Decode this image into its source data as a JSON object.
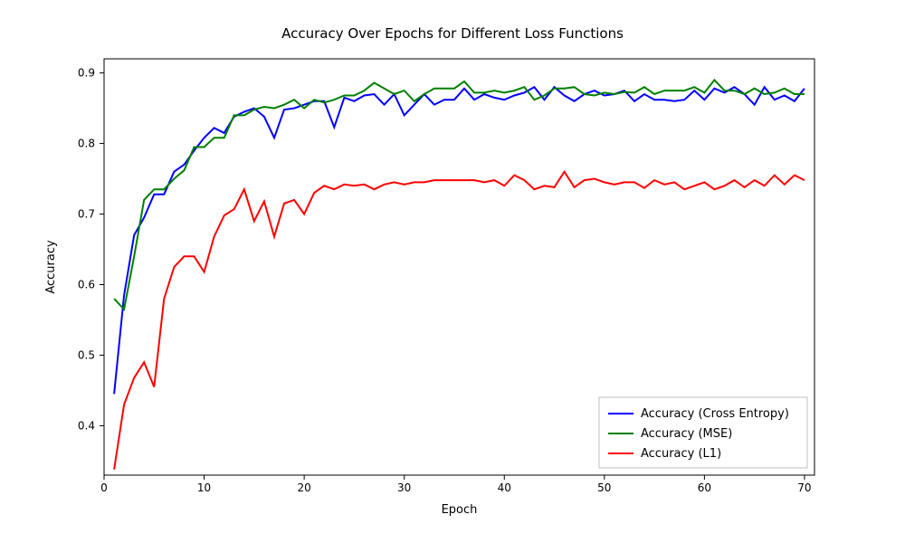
{
  "chart_data": {
    "type": "line",
    "title": "Accuracy Over Epochs for Different Loss Functions",
    "xlabel": "Epoch",
    "ylabel": "Accuracy",
    "xlim": [
      0,
      71
    ],
    "ylim": [
      0.33,
      0.92
    ],
    "xticks": [
      0,
      10,
      20,
      30,
      40,
      50,
      60,
      70
    ],
    "yticks": [
      0.4,
      0.5,
      0.6,
      0.7,
      0.8,
      0.9
    ],
    "x": [
      1,
      2,
      3,
      4,
      5,
      6,
      7,
      8,
      9,
      10,
      11,
      12,
      13,
      14,
      15,
      16,
      17,
      18,
      19,
      20,
      21,
      22,
      23,
      24,
      25,
      26,
      27,
      28,
      29,
      30,
      31,
      32,
      33,
      34,
      35,
      36,
      37,
      38,
      39,
      40,
      41,
      42,
      43,
      44,
      45,
      46,
      47,
      48,
      49,
      50,
      51,
      52,
      53,
      54,
      55,
      56,
      57,
      58,
      59,
      60,
      61,
      62,
      63,
      64,
      65,
      66,
      67,
      68,
      69,
      70
    ],
    "series": [
      {
        "name": "Accuracy (Cross Entropy)",
        "color": "#0000ff",
        "values": [
          0.445,
          0.585,
          0.67,
          0.695,
          0.728,
          0.728,
          0.76,
          0.77,
          0.79,
          0.808,
          0.822,
          0.815,
          0.838,
          0.845,
          0.85,
          0.838,
          0.808,
          0.848,
          0.85,
          0.855,
          0.86,
          0.86,
          0.823,
          0.865,
          0.86,
          0.868,
          0.87,
          0.855,
          0.87,
          0.84,
          0.855,
          0.87,
          0.855,
          0.862,
          0.862,
          0.878,
          0.862,
          0.87,
          0.865,
          0.862,
          0.868,
          0.872,
          0.88,
          0.862,
          0.88,
          0.868,
          0.86,
          0.87,
          0.875,
          0.868,
          0.87,
          0.875,
          0.86,
          0.87,
          0.862,
          0.862,
          0.86,
          0.862,
          0.875,
          0.862,
          0.878,
          0.872,
          0.88,
          0.87,
          0.855,
          0.88,
          0.862,
          0.868,
          0.86,
          0.878
        ]
      },
      {
        "name": "Accuracy (MSE)",
        "color": "#008000",
        "values": [
          0.58,
          0.565,
          0.64,
          0.72,
          0.735,
          0.735,
          0.75,
          0.762,
          0.795,
          0.795,
          0.808,
          0.808,
          0.84,
          0.84,
          0.848,
          0.852,
          0.85,
          0.855,
          0.862,
          0.85,
          0.862,
          0.858,
          0.862,
          0.868,
          0.868,
          0.875,
          0.886,
          0.878,
          0.87,
          0.875,
          0.86,
          0.87,
          0.878,
          0.878,
          0.878,
          0.888,
          0.872,
          0.872,
          0.875,
          0.872,
          0.875,
          0.88,
          0.862,
          0.868,
          0.878,
          0.878,
          0.88,
          0.87,
          0.868,
          0.872,
          0.87,
          0.873,
          0.872,
          0.88,
          0.87,
          0.875,
          0.875,
          0.875,
          0.88,
          0.872,
          0.89,
          0.875,
          0.875,
          0.87,
          0.878,
          0.87,
          0.872,
          0.878,
          0.87,
          0.87
        ]
      },
      {
        "name": "Accuracy (L1)",
        "color": "#ff0000",
        "values": [
          0.338,
          0.43,
          0.468,
          0.49,
          0.455,
          0.58,
          0.625,
          0.64,
          0.64,
          0.618,
          0.668,
          0.698,
          0.707,
          0.735,
          0.69,
          0.718,
          0.668,
          0.715,
          0.72,
          0.7,
          0.73,
          0.74,
          0.735,
          0.742,
          0.74,
          0.742,
          0.735,
          0.742,
          0.745,
          0.742,
          0.745,
          0.745,
          0.748,
          0.748,
          0.748,
          0.748,
          0.748,
          0.745,
          0.748,
          0.74,
          0.755,
          0.748,
          0.735,
          0.74,
          0.738,
          0.76,
          0.738,
          0.748,
          0.75,
          0.745,
          0.742,
          0.745,
          0.745,
          0.737,
          0.748,
          0.742,
          0.745,
          0.735,
          0.74,
          0.745,
          0.735,
          0.74,
          0.748,
          0.738,
          0.748,
          0.74,
          0.755,
          0.742,
          0.755,
          0.748
        ]
      }
    ],
    "legend_position": "lower right"
  }
}
